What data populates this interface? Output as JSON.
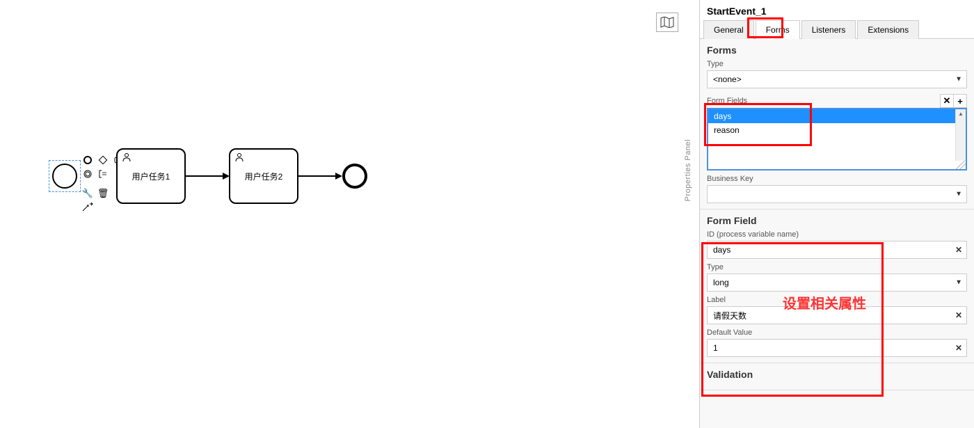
{
  "canvas": {
    "task1_label": "用户任务1",
    "task2_label": "用户任务2"
  },
  "minimap_icon": "map-icon",
  "sidebar_label": "Properties Panel",
  "panel": {
    "element_name": "StartEvent_1",
    "tabs": {
      "general": "General",
      "forms": "Forms",
      "listeners": "Listeners",
      "extensions": "Extensions"
    },
    "forms_section": {
      "title": "Forms",
      "type_label": "Type",
      "type_value": "<none>",
      "form_fields_label": "Form Fields",
      "form_fields": [
        "days",
        "reason"
      ],
      "selected_field_index": 0,
      "business_key_label": "Business Key",
      "business_key_value": ""
    },
    "form_field_section": {
      "title": "Form Field",
      "id_label": "ID (process variable name)",
      "id_value": "days",
      "type_label": "Type",
      "type_value": "long",
      "label_label": "Label",
      "label_value": "请假天数",
      "default_label": "Default Value",
      "default_value": "1"
    },
    "validation_title": "Validation"
  },
  "annotation": "设置相关属性"
}
